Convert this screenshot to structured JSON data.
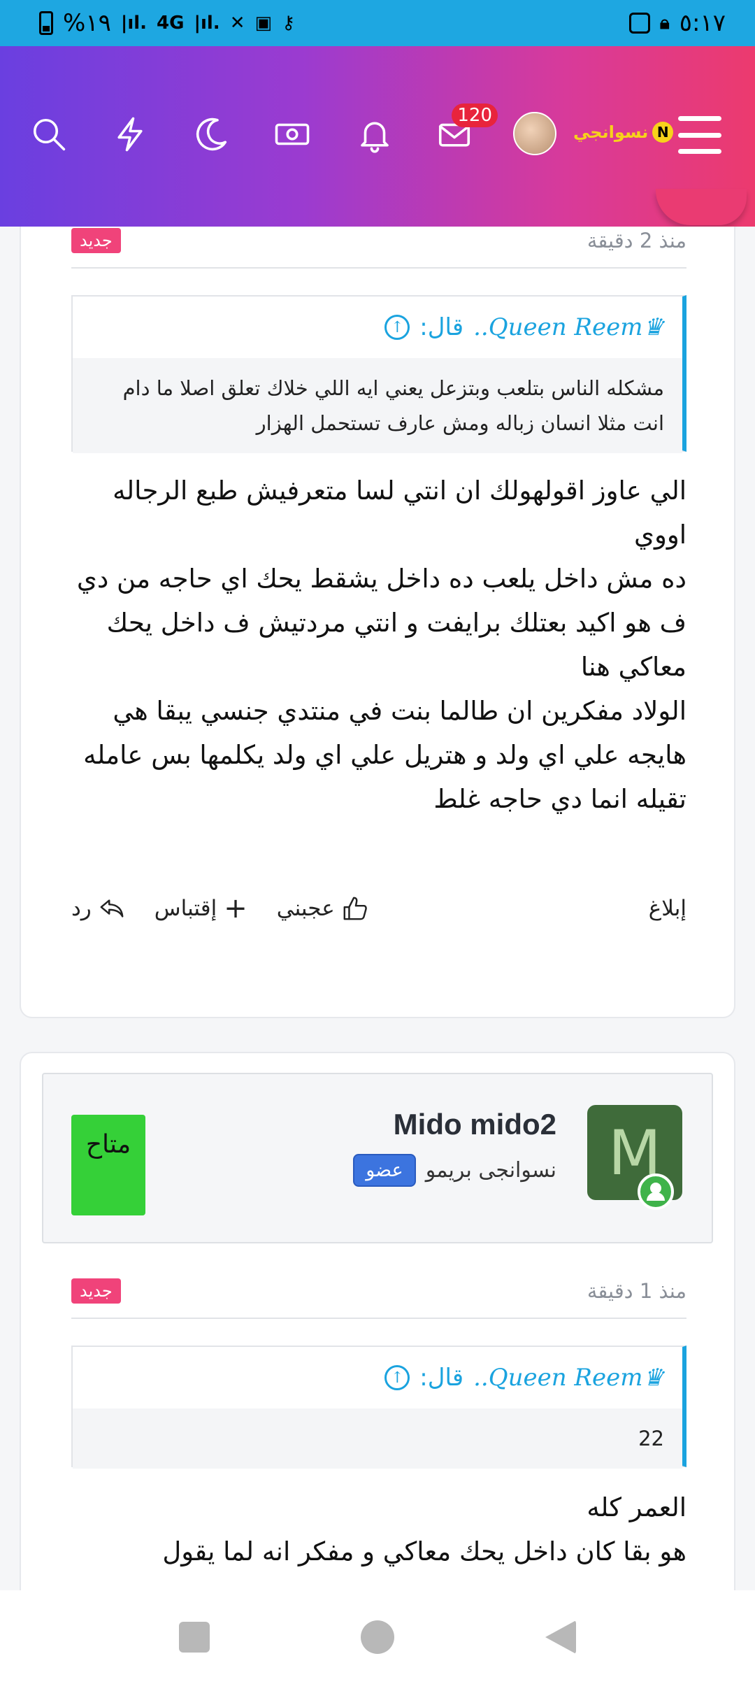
{
  "status_bar": {
    "time": "٥:١٧",
    "battery": "%١٩",
    "network": "4G"
  },
  "header": {
    "logo_text": "نسوانجي",
    "logo_letter": "N",
    "messages_count": "120",
    "icons": [
      "search-icon",
      "lightning-icon",
      "moon-icon",
      "money-icon",
      "bell-icon",
      "mail-icon"
    ]
  },
  "posts": [
    {
      "time": "منذ 2 دقيقة",
      "badge": "جديد",
      "quote_author": "♛Queen Reem..",
      "quote_said": "قال:",
      "quote_text": "مشكله الناس بتلعب وبتزعل يعني ايه اللي خلاك تعلق اصلا ما دام انت مثلا انسان زباله ومش عارف تستحمل الهزار",
      "lines": [
        "الي عاوز اقولهولك ان انتي لسا متعرفيش طبع الرجاله اووي",
        "ده مش داخل يلعب ده داخل يشقط يحك اي حاجه من دي",
        "ف هو اكيد بعتلك برايفت و انتي مردتيش ف داخل يحك معاكي هنا",
        "الولاد مفكرين ان طالما بنت في منتدي جنسي يبقا هي هايجه علي اي ولد و هتريل علي اي ولد يكلمها بس عامله تقيله انما دي حاجه غلط"
      ],
      "actions": {
        "report": "إبلاغ",
        "like": "عجبني",
        "quote": "إقتباس",
        "reply": "رد"
      }
    },
    {
      "time": "منذ 1 دقيقة",
      "badge": "جديد",
      "quote_author": "♛Queen Reem..",
      "quote_said": "قال:",
      "quote_text": "22",
      "lines": [
        "العمر كله",
        "هو بقا كان داخل يحك معاكي و مفكر انه لما يقول"
      ]
    }
  ],
  "user": {
    "name": "Mido mido2",
    "initial": "M",
    "rank": "نسوانجى بريمو",
    "role": "عضو",
    "status": "متاح"
  },
  "colors": {
    "status_bar": "#1ea7e1",
    "header_start": "#6a3fe0",
    "header_end": "#ec3a6e",
    "accent_blue": "#1aa3df",
    "new_badge": "#f0437a",
    "available": "#35d038"
  }
}
